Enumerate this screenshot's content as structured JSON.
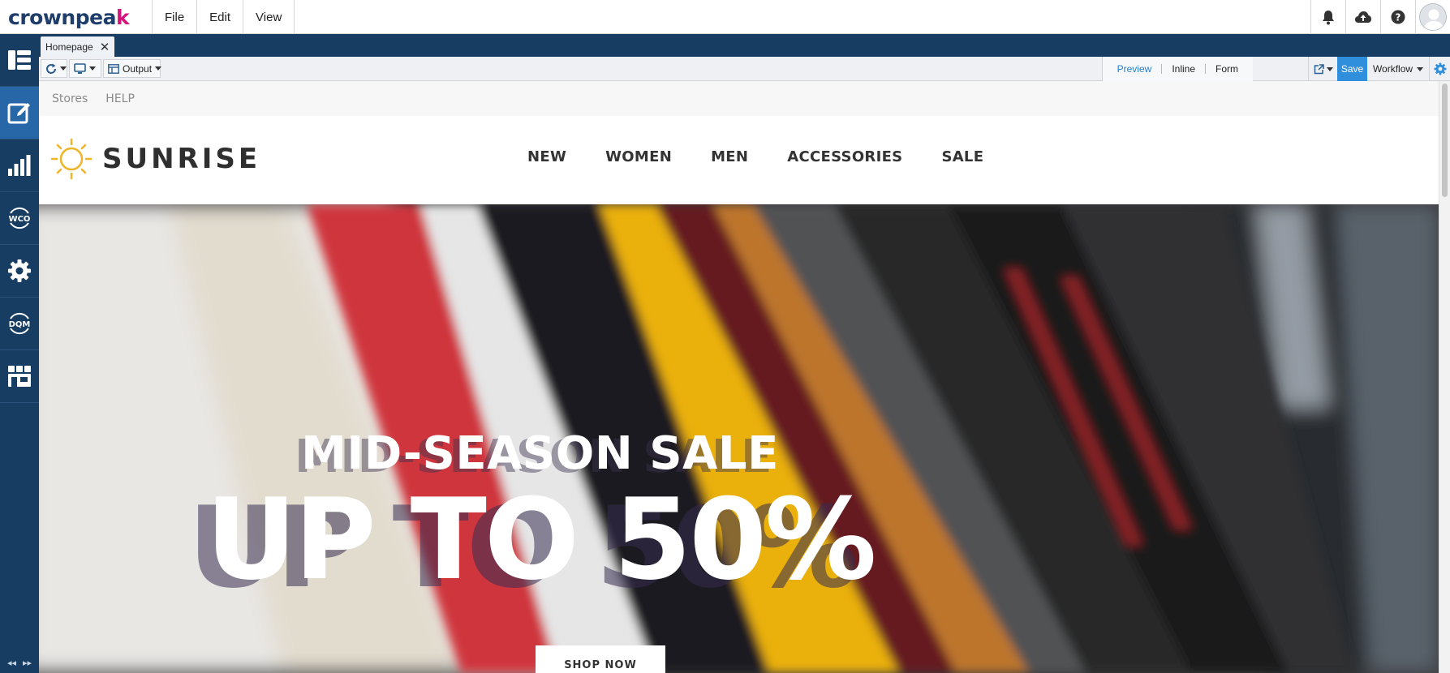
{
  "app": {
    "logo_main": "crownpea",
    "logo_accent": "k",
    "menu": [
      "File",
      "Edit",
      "View"
    ],
    "top_icons": [
      "bell-icon",
      "cloud-upload-icon",
      "help-icon",
      "user-avatar"
    ]
  },
  "sidebar": {
    "items": [
      {
        "icon": "dashboard-icon",
        "active": false
      },
      {
        "icon": "edit-icon",
        "active": true
      },
      {
        "icon": "analytics-icon",
        "active": false
      },
      {
        "icon": "wco-icon",
        "label": "WCO",
        "active": false
      },
      {
        "icon": "settings-icon",
        "active": false
      },
      {
        "icon": "dqm-icon",
        "label": "DQM",
        "active": false
      },
      {
        "icon": "marketplace-icon",
        "active": false
      }
    ]
  },
  "tabs": [
    {
      "label": "Homepage"
    }
  ],
  "toolbar": {
    "output_label": "Output",
    "modes": [
      "Preview",
      "Inline",
      "Form"
    ],
    "selected_mode": "Preview",
    "save_label": "Save",
    "workflow_label": "Workflow"
  },
  "site": {
    "utility_links": [
      "Stores",
      "HELP"
    ],
    "brand": "SUNRISE",
    "nav": [
      "NEW",
      "WOMEN",
      "MEN",
      "ACCESSORIES",
      "SALE"
    ],
    "hero_line1": "MID-SEASON SALE",
    "hero_line2": "UP TO 50%",
    "cta": "SHOP NOW"
  },
  "colors": {
    "navy": "#173d62",
    "sidebar_active": "#2766a7",
    "save_blue": "#2f8fdd",
    "logo_pink": "#d4147a",
    "sun_yellow": "#f0b429"
  }
}
